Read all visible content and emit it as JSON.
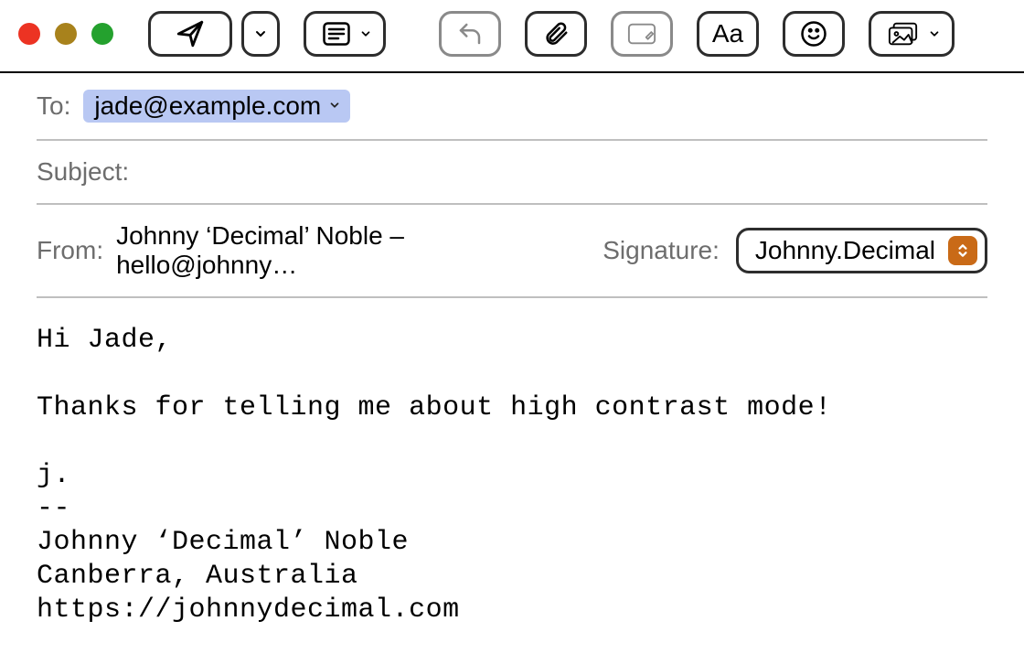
{
  "fields": {
    "to_label": "To:",
    "to_recipient": "jade@example.com",
    "subject_label": "Subject:",
    "subject_value": "",
    "from_label": "From:",
    "from_value": "Johnny ‘Decimal’ Noble – hello@johnny…",
    "signature_label": "Signature:",
    "signature_selected": "Johnny.Decimal"
  },
  "toolbar": {
    "format_text": "Aa"
  },
  "body_text": "Hi Jade,\n\nThanks for telling me about high contrast mode!\n\nj.\n--\nJohnny ‘Decimal’ Noble\nCanberra, Australia\nhttps://johnnydecimal.com"
}
